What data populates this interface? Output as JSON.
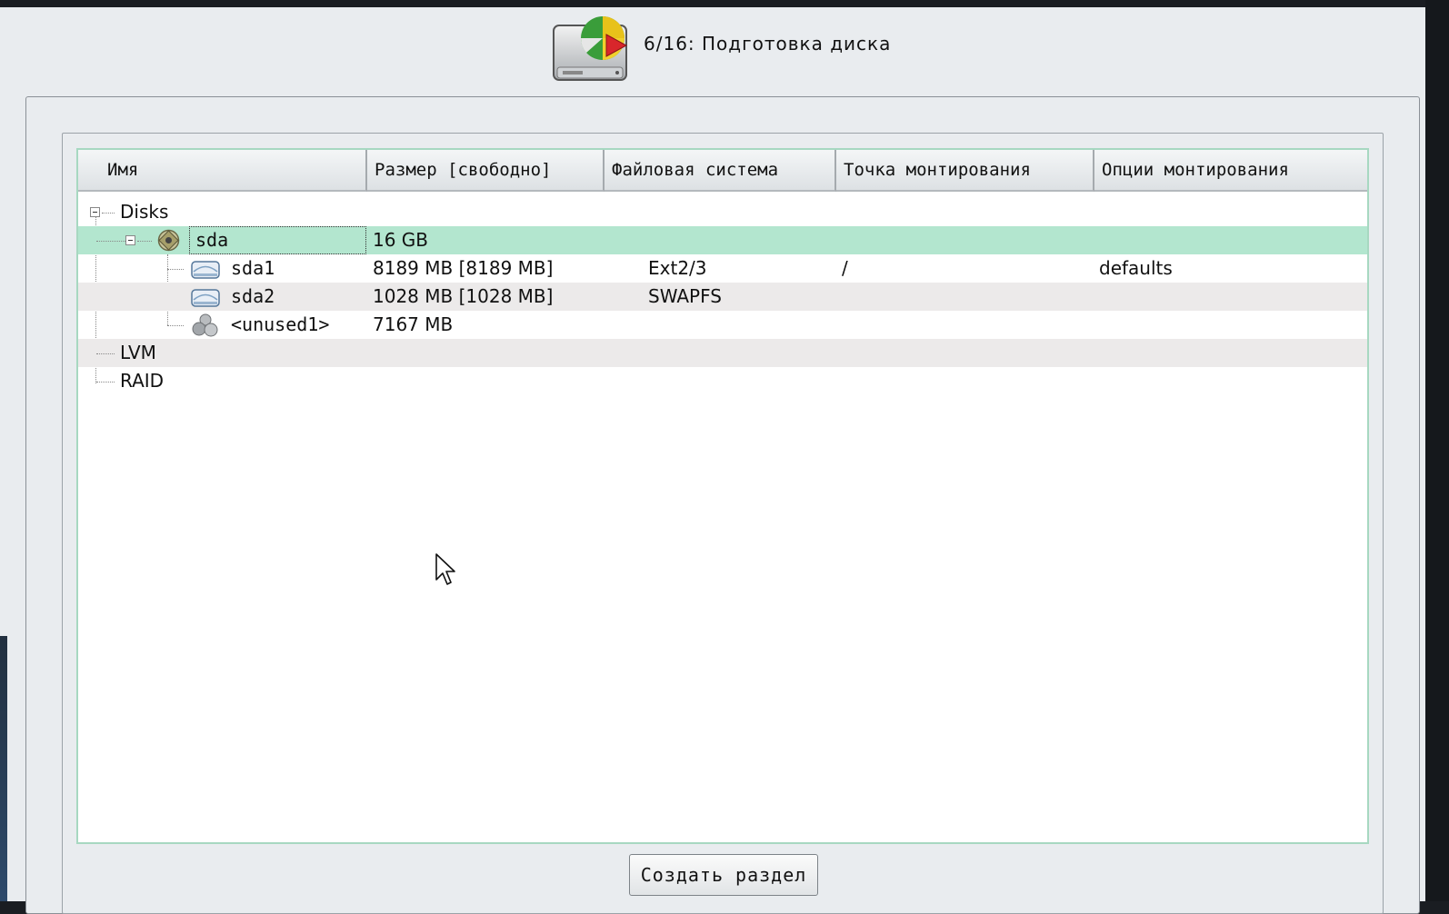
{
  "header": {
    "title": "6/16: Подготовка диска",
    "icon": "disk-partition-icon"
  },
  "tree": {
    "columns": [
      {
        "label": "Имя"
      },
      {
        "label": "Размер [свободно]"
      },
      {
        "label": "Файловая система"
      },
      {
        "label": "Точка монтирования"
      },
      {
        "label": "Опции монтирования"
      }
    ],
    "rows": [
      {
        "name": "Disks",
        "size": "",
        "fs": "",
        "mount": "",
        "options": ""
      },
      {
        "name": "sda",
        "size": "16 GB",
        "fs": "",
        "mount": "",
        "options": "",
        "selected": true
      },
      {
        "name": "sda1",
        "size": "8189 MB [8189 MB]",
        "fs": "Ext2/3",
        "mount": "/",
        "options": "defaults"
      },
      {
        "name": "sda2",
        "size": "1028 MB [1028 MB]",
        "fs": "SWAPFS",
        "mount": "",
        "options": ""
      },
      {
        "name": "<unused1>",
        "size": "7167 MB",
        "fs": "",
        "mount": "",
        "options": ""
      },
      {
        "name": "LVM",
        "size": "",
        "fs": "",
        "mount": "",
        "options": ""
      },
      {
        "name": "RAID",
        "size": "",
        "fs": "",
        "mount": "",
        "options": ""
      }
    ]
  },
  "actions": {
    "create_partition": "Создать раздел"
  },
  "colors": {
    "selection": "#b3e6cf",
    "panel_border": "#a7d8c1",
    "background": "#e9ecef"
  }
}
